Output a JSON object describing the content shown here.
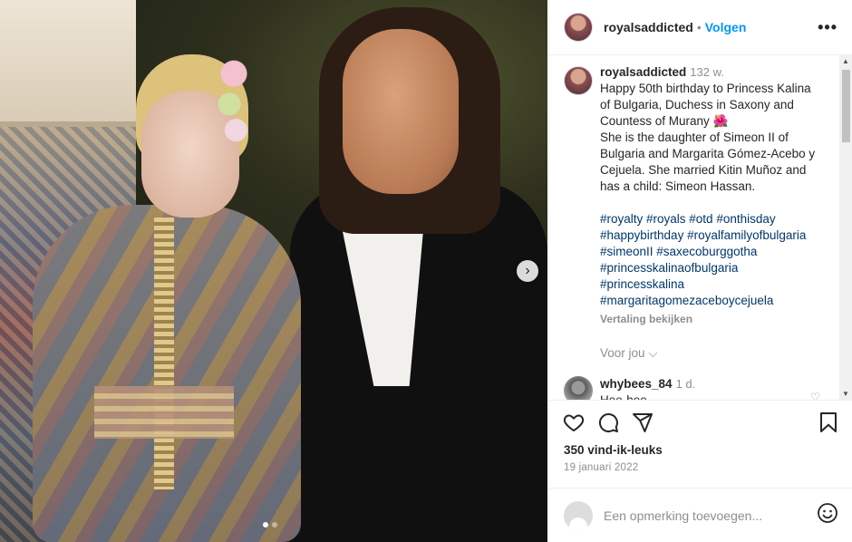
{
  "post": {
    "username": "royalsaddicted",
    "follow_label": "Volgen",
    "more_label": "•••",
    "separator": "•"
  },
  "caption": {
    "username": "royalsaddicted",
    "time": "132 w.",
    "lines": [
      "Happy 50th birthday to Princess Kalina",
      "of Bulgaria, Duchess in Saxony and",
      "Countess of Murany 🌺",
      "She is the daughter of Simeon II of",
      "Bulgaria and Margarita Gómez-Acebo y",
      "Cejuela. She married Kitin Muñoz and",
      "has a child: Simeon Hassan."
    ],
    "hashtags": [
      "#royalty #royals #otd #onthisday",
      "#happybirthday #royalfamilyofbulgaria",
      "#simeonII #saxecoburggotha",
      "#princesskalinaofbulgaria",
      "#princesskalina",
      "#margaritagomezaceboycejuela"
    ],
    "translate_label": "Vertaling bekijken",
    "for_you_label": "Voor jou ⌵"
  },
  "comment": {
    "username": "whybees_84",
    "time": "1 d.",
    "text": "Hee-hee"
  },
  "stats": {
    "likes": "350 vind-ik-leuks",
    "date": "19 januari 2022"
  },
  "add_comment": {
    "placeholder": "Een opmerking toevoegen..."
  },
  "icons": {
    "like": "heart-icon",
    "comment": "comment-icon",
    "share": "share-icon",
    "save": "bookmark-icon",
    "emoji": "emoji-icon",
    "next": "chevron-right-icon"
  },
  "colors": {
    "accent": "#0095f6",
    "hashtag": "#00376b",
    "secondary_text": "#8e8e8e"
  },
  "carousel": {
    "total": 2,
    "current": 1
  }
}
